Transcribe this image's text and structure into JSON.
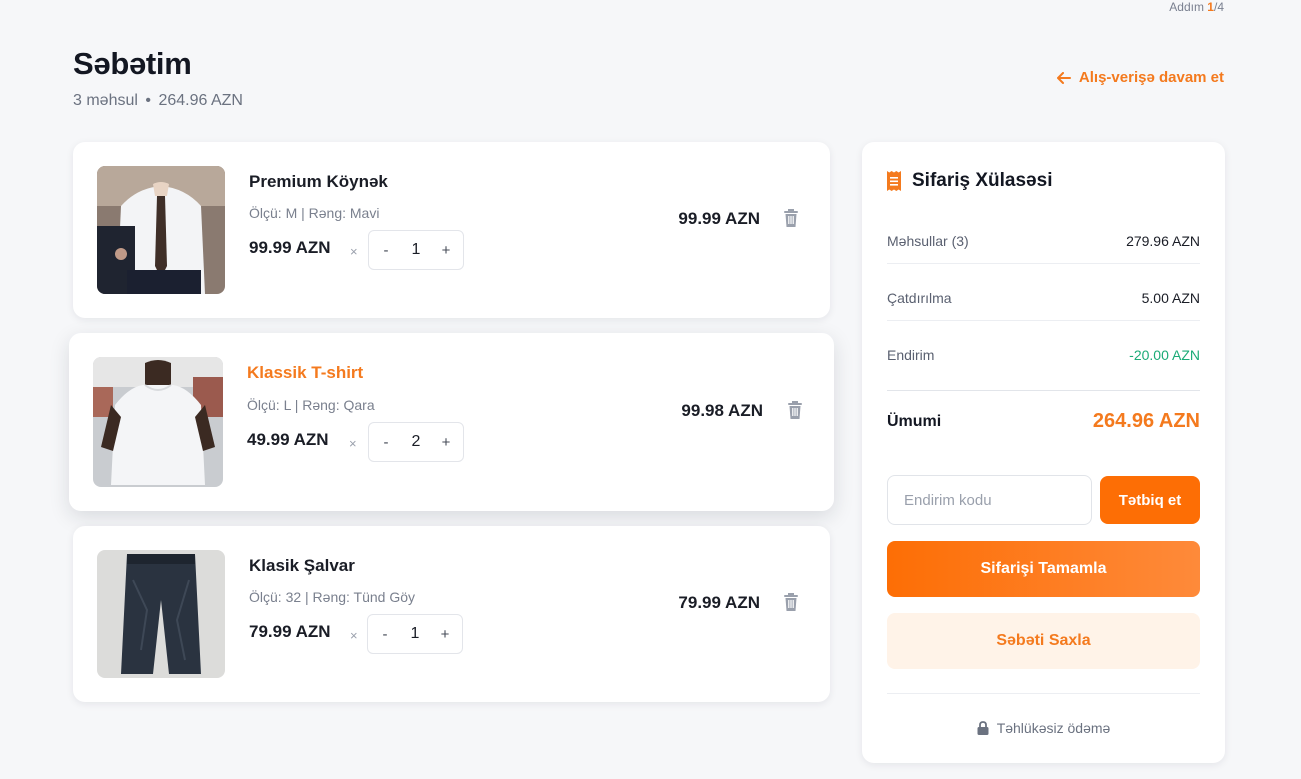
{
  "step": {
    "prefix": "Addım ",
    "current": "1",
    "rest": "/4"
  },
  "header": {
    "title": "Səbətim",
    "count": "3 məhsul",
    "sep": "•",
    "amount": "264.96 AZN"
  },
  "continue_link": "Alış-verişə davam et",
  "items": [
    {
      "name": "Premium Köynək",
      "meta": "Ölçü: M | Rəng: Mavi",
      "price": "99.99 AZN",
      "times": "×",
      "qty": "1",
      "total": "99.99 AZN",
      "minus": "-",
      "plus": "+"
    },
    {
      "name": "Klassik T-shirt",
      "meta": "Ölçü: L | Rəng: Qara",
      "price": "49.99 AZN",
      "times": "×",
      "qty": "2",
      "total": "99.98 AZN",
      "minus": "-",
      "plus": "+"
    },
    {
      "name": "Klasik Şalvar",
      "meta": "Ölçü: 32 | Rəng: Tünd Göy",
      "price": "79.99 AZN",
      "times": "×",
      "qty": "1",
      "total": "79.99 AZN",
      "minus": "-",
      "plus": "+"
    }
  ],
  "summary": {
    "title": "Sifariş Xülasəsi",
    "rows": [
      {
        "label": "Məhsullar (3)",
        "value": "279.96 AZN"
      },
      {
        "label": "Çatdırılma",
        "value": "5.00 AZN"
      },
      {
        "label": "Endirim",
        "value": "-20.00 AZN"
      }
    ],
    "total_label": "Ümumi",
    "total_value": "264.96 AZN",
    "promo_placeholder": "Endirim kodu",
    "apply_label": "Tətbiq et",
    "checkout_label": "Sifarişi Tamamla",
    "save_label": "Səbəti Saxla",
    "secure_label": "Təhlükəsiz ödəmə"
  },
  "colors": {
    "accent": "#f47a1e",
    "discount": "#1bab77"
  },
  "icons": [
    "arrow-left-icon",
    "trash-icon",
    "receipt-icon",
    "lock-icon"
  ]
}
